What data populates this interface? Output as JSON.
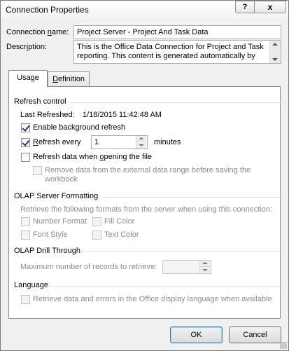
{
  "window": {
    "title": "Connection Properties"
  },
  "titlebar": {
    "help_glyph": "?",
    "close_glyph": "x"
  },
  "connection": {
    "name_label_pre": "Connection ",
    "name_label_mnemonic": "n",
    "name_label_post": "ame:",
    "name_value": "Project Server - Project And Task Data",
    "description_label_pre": "Descr",
    "description_label_mnemonic": "i",
    "description_label_post": "ption:",
    "description_value": "This is the Office Data Connection for Project and Task reporting. This content is generated automatically by"
  },
  "tabs": [
    {
      "label": "Usage",
      "selected": true
    },
    {
      "label_mnemonic": "D",
      "label_rest": "efinition",
      "selected": false
    }
  ],
  "refresh_control": {
    "heading": "Refresh control",
    "last_refreshed_label": "Last Refreshed:",
    "last_refreshed_value": "1/18/2015  11:42:48 AM",
    "background_refresh": {
      "pre": "Enable back",
      "mn": "g",
      "post": "round refresh",
      "checked": true
    },
    "refresh_every": {
      "mn": "R",
      "post": "efresh every",
      "checked": true,
      "value": "1",
      "unit": "minutes"
    },
    "refresh_on_open": {
      "pre": "Refresh data when ",
      "mn": "o",
      "post": "pening the file",
      "checked": false
    },
    "remove_data": {
      "line1": "Remove data from the external data range before saving the",
      "line2": "workbook",
      "checked": false,
      "enabled": false
    }
  },
  "olap_formatting": {
    "heading": "OLAP Server Formatting",
    "description": "Retrieve the following formats from the server when using this connection:",
    "number_format": "Number Format",
    "fill_color": "Fill Color",
    "font_style": "Font Style",
    "text_color": "Text Color"
  },
  "olap_drill": {
    "heading": "OLAP Drill Through",
    "max_records_label": "Maximum number of records to retrieve:",
    "max_records_value": ""
  },
  "language": {
    "heading": "Language",
    "option": "Retrieve data and errors in the Office display language when available"
  },
  "buttons": {
    "ok": "OK",
    "cancel": "Cancel"
  },
  "colors": {
    "accent": "#3c7fb1",
    "disabled_text": "#8c8c8c",
    "group_line": "#d5dfe5"
  }
}
